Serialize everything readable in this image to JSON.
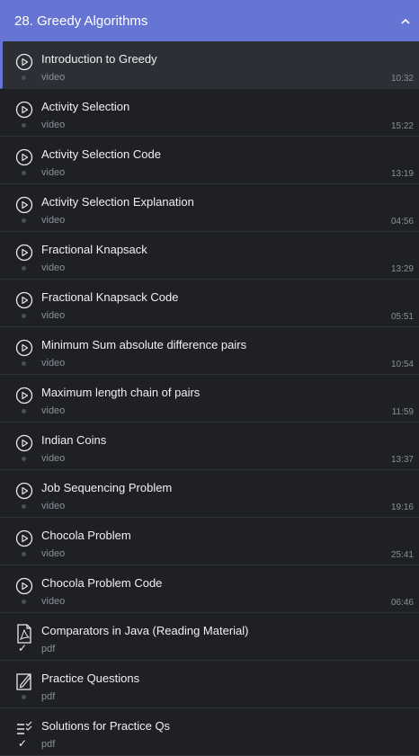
{
  "section": {
    "title": "28. Greedy Algorithms"
  },
  "items": [
    {
      "label": "Introduction to Greedy",
      "type": "video",
      "duration": "10:32",
      "icon": "play-circle-icon",
      "status": "dot",
      "active": true
    },
    {
      "label": "Activity Selection",
      "type": "video",
      "duration": "15:22",
      "icon": "play-circle-icon",
      "status": "dot"
    },
    {
      "label": "Activity Selection Code",
      "type": "video",
      "duration": "13:19",
      "icon": "play-circle-icon",
      "status": "dot"
    },
    {
      "label": "Activity Selection Explanation",
      "type": "video",
      "duration": "04:56",
      "icon": "play-circle-icon",
      "status": "dot"
    },
    {
      "label": "Fractional Knapsack",
      "type": "video",
      "duration": "13:29",
      "icon": "play-circle-icon",
      "status": "dot"
    },
    {
      "label": "Fractional Knapsack Code",
      "type": "video",
      "duration": "05:51",
      "icon": "play-circle-icon",
      "status": "dot"
    },
    {
      "label": "Minimum Sum absolute difference pairs",
      "type": "video",
      "duration": "10:54",
      "icon": "play-circle-icon",
      "status": "dot"
    },
    {
      "label": "Maximum length chain of pairs",
      "type": "video",
      "duration": "11:59",
      "icon": "play-circle-icon",
      "status": "dot"
    },
    {
      "label": "Indian Coins",
      "type": "video",
      "duration": "13:37",
      "icon": "play-circle-icon",
      "status": "dot"
    },
    {
      "label": "Job Sequencing Problem",
      "type": "video",
      "duration": "19:16",
      "icon": "play-circle-icon",
      "status": "dot"
    },
    {
      "label": "Chocola Problem",
      "type": "video",
      "duration": "25:41",
      "icon": "play-circle-icon",
      "status": "dot"
    },
    {
      "label": "Chocola Problem Code",
      "type": "video",
      "duration": "06:46",
      "icon": "play-circle-icon",
      "status": "dot"
    },
    {
      "label": "Comparators in Java (Reading Material)",
      "type": "pdf",
      "duration": "",
      "icon": "pdf-icon",
      "status": "check"
    },
    {
      "label": "Practice Questions",
      "type": "pdf",
      "duration": "",
      "icon": "edit-note-icon",
      "status": "dot"
    },
    {
      "label": "Solutions for Practice Qs",
      "type": "pdf",
      "duration": "",
      "icon": "checklist-icon",
      "status": "check"
    }
  ],
  "colors": {
    "header": "#6674d4",
    "background": "#1e2024",
    "active": "#2c2f35"
  }
}
